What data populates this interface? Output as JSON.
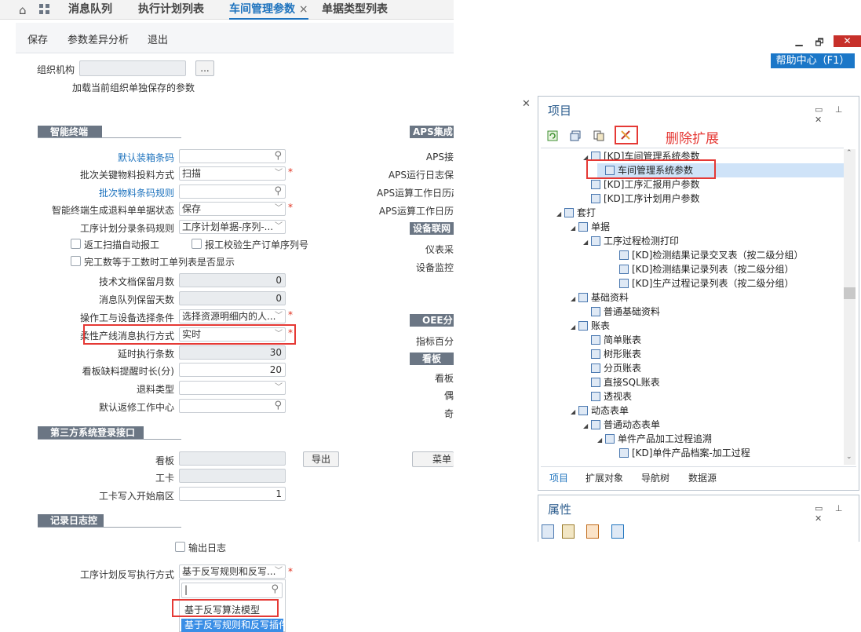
{
  "tabs": [
    {
      "label": "消息队列"
    },
    {
      "label": "执行计划列表"
    },
    {
      "label": "车间管理参数",
      "close": "×"
    },
    {
      "label": "单据类型列表"
    }
  ],
  "toolbar": {
    "save": "保存",
    "diff": "参数差异分析",
    "exit": "退出"
  },
  "org": {
    "label": "组织机构",
    "browse": "...",
    "note": "加载当前组织单独保存的参数"
  },
  "sections": {
    "smart": "智能终端",
    "third": "第三方系统登录接口",
    "log": "记录日志控制",
    "aps": "APS集成",
    "device": "设备联网",
    "oee": "OEE分析",
    "board": "看板"
  },
  "fields": [
    {
      "label": "默认装箱条码",
      "value": "",
      "type": "search",
      "link": true
    },
    {
      "label": "批次关键物料投料方式",
      "value": "扫描",
      "type": "select",
      "req": "*"
    },
    {
      "label": "批次物料条码规则",
      "value": "",
      "type": "search",
      "link": true
    },
    {
      "label": "智能终端生成退料单单据状态",
      "value": "保存",
      "type": "select",
      "req": "*"
    },
    {
      "label": "工序计划分录条码规则",
      "value": "工序计划单据-序列-...",
      "type": "select"
    }
  ],
  "checks": {
    "c1": "返工扫描自动报工",
    "c2": "报工校验生产订单序列号",
    "c3": "完工数等于工数时工单列表是否显示"
  },
  "fields2": [
    {
      "label": "技术文档保留月数",
      "value": "0"
    },
    {
      "label": "消息队列保留天数",
      "value": "0"
    }
  ],
  "fields3": [
    {
      "label": "操作工与设备选择条件",
      "value": "选择资源明细内的人...",
      "req": "*"
    },
    {
      "label": "柔性产线消息执行方式",
      "value": "实时",
      "req": "*"
    }
  ],
  "fields4": [
    {
      "label": "延时执行条数",
      "value": "30"
    },
    {
      "label": "看板缺料提醒时长(分)",
      "value": "20"
    },
    {
      "label": "退料类型",
      "value": ""
    },
    {
      "label": "默认返修工作中心",
      "value": ""
    }
  ],
  "third": {
    "board": "看板",
    "export": "导出",
    "menu": "菜单",
    "card": "工卡",
    "sector": "工卡写入开始扇区",
    "sector_val": "1"
  },
  "log": {
    "output": "输出日志",
    "writeback_label": "工序计划反写执行方式",
    "writeback_value": "基于反写规则和反写...",
    "req": "*",
    "opt1": "基于反写算法模型",
    "opt2": "基于反写规则和反写插件",
    "cursor": "|"
  },
  "right_labels": [
    "APS接",
    "APS运行日志保",
    "APS运算工作日历起",
    "APS运算工作日历",
    "仪表采",
    "设备监控",
    "指标百分",
    "看板",
    "偶",
    "奇"
  ],
  "window": {
    "min": "▁",
    "restore": "🗗",
    "close": "✕",
    "help": "帮助中心（F1）"
  },
  "project": {
    "title": "项目",
    "delete_label": "删除扩展",
    "tree": [
      {
        "t": "[KD]车间管理系统参数",
        "lvl": 3,
        "arrow": "◢"
      },
      {
        "t": "车间管理系统参数",
        "lvl": 4,
        "arrow": "",
        "sel": true
      },
      {
        "t": "[KD]工序汇报用户参数",
        "lvl": 3,
        "arrow": ""
      },
      {
        "t": "[KD]工序计划用户参数",
        "lvl": 3,
        "arrow": ""
      },
      {
        "t": "套打",
        "lvl": 1,
        "arrow": "◢"
      },
      {
        "t": "单据",
        "lvl": 2,
        "arrow": "◢"
      },
      {
        "t": "工序过程检测打印",
        "lvl": 3,
        "arrow": "◢"
      },
      {
        "t": "[KD]检测结果记录交叉表（按二级分组）",
        "lvl": 5,
        "arrow": ""
      },
      {
        "t": "[KD]检测结果记录列表（按二级分组）",
        "lvl": 5,
        "arrow": ""
      },
      {
        "t": "[KD]生产过程记录列表（按二级分组）",
        "lvl": 5,
        "arrow": ""
      },
      {
        "t": "基础资料",
        "lvl": 2,
        "arrow": "◢"
      },
      {
        "t": "普通基础资料",
        "lvl": 3,
        "arrow": ""
      },
      {
        "t": "账表",
        "lvl": 2,
        "arrow": "◢"
      },
      {
        "t": "简单账表",
        "lvl": 3,
        "arrow": ""
      },
      {
        "t": "树形账表",
        "lvl": 3,
        "arrow": ""
      },
      {
        "t": "分页账表",
        "lvl": 3,
        "arrow": ""
      },
      {
        "t": "直接SQL账表",
        "lvl": 3,
        "arrow": ""
      },
      {
        "t": "透视表",
        "lvl": 3,
        "arrow": ""
      },
      {
        "t": "动态表单",
        "lvl": 2,
        "arrow": "◢"
      },
      {
        "t": "普通动态表单",
        "lvl": 3,
        "arrow": "◢"
      },
      {
        "t": "单件产品加工过程追溯",
        "lvl": 4,
        "arrow": "◢"
      },
      {
        "t": "[KD]单件产品档案-加工过程",
        "lvl": 5,
        "arrow": ""
      }
    ],
    "bottom_tabs": [
      "项目",
      "扩展对象",
      "导航树",
      "数据源"
    ]
  },
  "props": {
    "title": "属性"
  },
  "colors": {
    "accent": "#1e73be",
    "red": "#e53935",
    "header": "#6b7684"
  }
}
